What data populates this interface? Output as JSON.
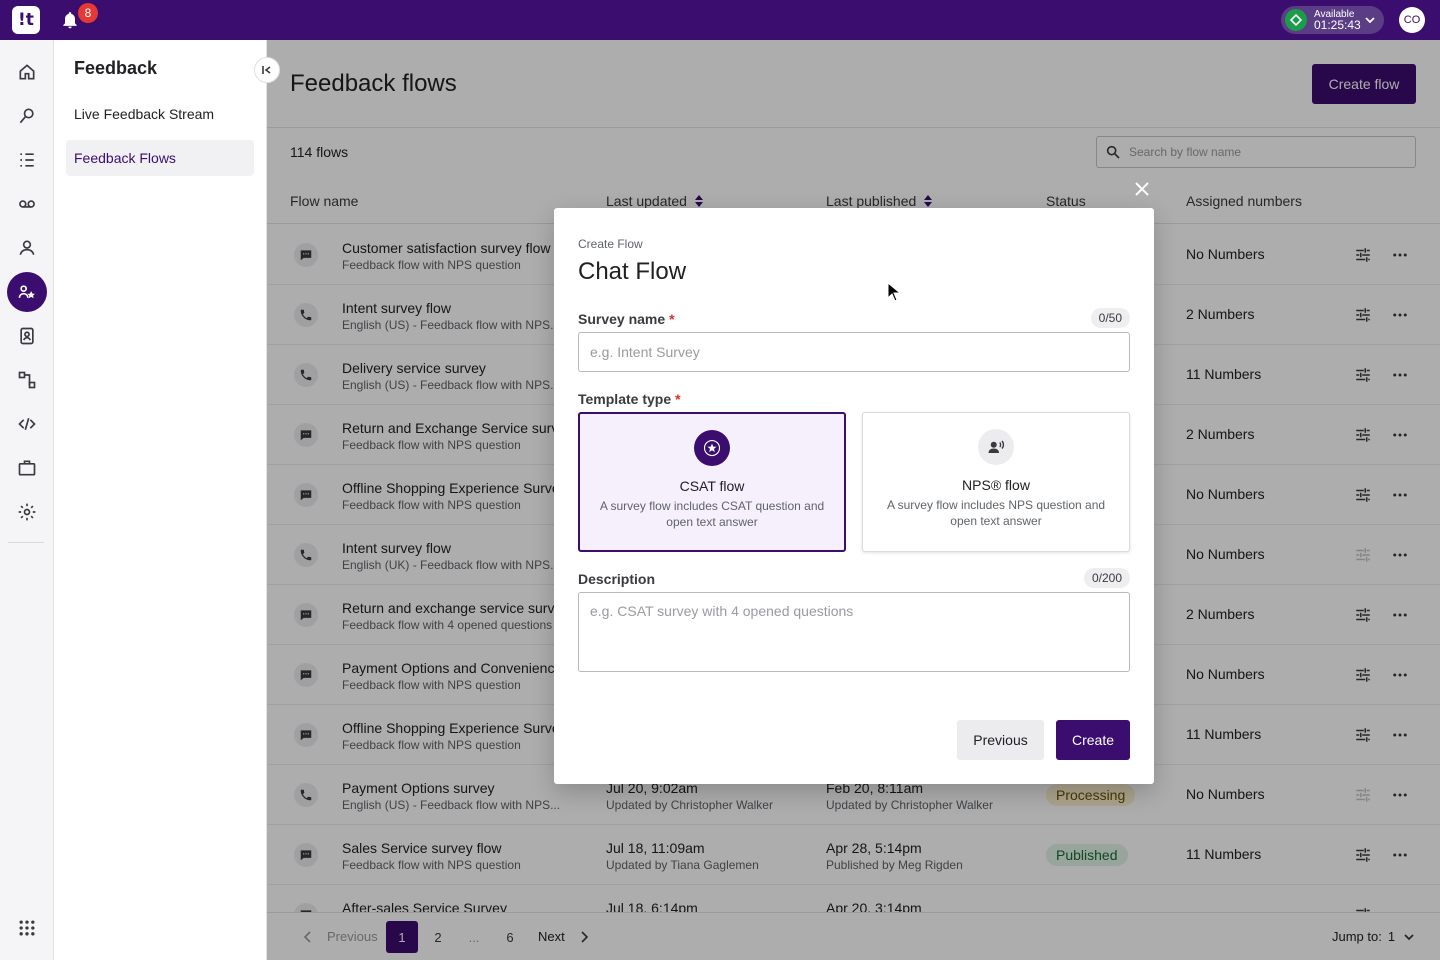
{
  "topbar": {
    "logo_text": "!t",
    "notifications_count": "8",
    "status_label": "Available",
    "status_timer": "01:25:43",
    "avatar_initials": "CO"
  },
  "rail": {
    "items": [
      "home-icon",
      "marketing-icon",
      "list-icon",
      "voicemail-icon",
      "agents-icon",
      "feedback-icon",
      "contacts-icon",
      "routing-icon",
      "code-icon",
      "briefcase-icon",
      "settings-icon",
      "apps-grid-icon"
    ],
    "active": "feedback-icon"
  },
  "sidebar": {
    "title": "Feedback",
    "items": [
      {
        "label": "Live Feedback Stream"
      },
      {
        "label": "Feedback Flows"
      }
    ]
  },
  "main": {
    "title": "Feedback flows",
    "create_label": "Create flow",
    "count": "114 flows",
    "search_placeholder": "Search by flow name",
    "columns": [
      "Flow name",
      "Last updated",
      "Last published",
      "Status",
      "Assigned numbers"
    ],
    "rows": [
      {
        "type": "chat",
        "name": "Customer satisfaction survey flow",
        "sub": "Feedback flow with NPS question",
        "updated": "",
        "updated_by": "",
        "published": "",
        "published_by": "",
        "status": "",
        "numbers": "No Numbers",
        "tune_disabled": false
      },
      {
        "type": "phone",
        "name": "Intent survey flow",
        "sub": "English (US) - Feedback flow with NPS...",
        "updated": "",
        "updated_by": "",
        "published": "",
        "published_by": "",
        "status": "",
        "numbers": "2 Numbers",
        "tune_disabled": false
      },
      {
        "type": "phone",
        "name": "Delivery service survey",
        "sub": "English (US) - Feedback flow with NPS...",
        "updated": "",
        "updated_by": "",
        "published": "",
        "published_by": "",
        "status": "",
        "numbers": "11 Numbers",
        "tune_disabled": false
      },
      {
        "type": "chat",
        "name": "Return and Exchange Service surv",
        "sub": "Feedback flow with NPS question",
        "updated": "",
        "updated_by": "",
        "published": "",
        "published_by": "",
        "status": "",
        "numbers": "2 Numbers",
        "tune_disabled": false
      },
      {
        "type": "chat",
        "name": "Offline Shopping Experience Surve",
        "sub": "Feedback flow with NPS question",
        "updated": "",
        "updated_by": "",
        "published": "",
        "published_by": "",
        "status": "",
        "numbers": "No Numbers",
        "tune_disabled": false
      },
      {
        "type": "phone",
        "name": "Intent survey flow",
        "sub": "English (UK) - Feedback flow with NPS...",
        "updated": "",
        "updated_by": "",
        "published": "",
        "published_by": "",
        "status": "",
        "numbers": "No Numbers",
        "tune_disabled": true
      },
      {
        "type": "chat",
        "name": "Return and exchange service surv",
        "sub": "Feedback flow with 4 opened questions",
        "updated": "",
        "updated_by": "",
        "published": "",
        "published_by": "",
        "status": "",
        "numbers": "2 Numbers",
        "tune_disabled": false
      },
      {
        "type": "chat",
        "name": "Payment Options and Convenienc",
        "sub": "Feedback flow with NPS question",
        "updated": "",
        "updated_by": "",
        "published": "",
        "published_by": "",
        "status": "",
        "numbers": "No Numbers",
        "tune_disabled": false
      },
      {
        "type": "chat",
        "name": "Offline Shopping Experience Surve",
        "sub": "Feedback flow with NPS question",
        "updated": "",
        "updated_by": "",
        "published": "",
        "published_by": "",
        "status": "",
        "numbers": "11 Numbers",
        "tune_disabled": false
      },
      {
        "type": "phone",
        "name": "Payment Options survey",
        "sub": "English (US) - Feedback flow with NPS...",
        "updated": "Jul 20, 9:02am",
        "updated_by": "Updated by Christopher Walker",
        "published": "Feb 20, 8:11am",
        "published_by": "Updated by Christopher Walker",
        "status": "Processing",
        "numbers": "No Numbers",
        "tune_disabled": true
      },
      {
        "type": "chat",
        "name": "Sales Service survey flow",
        "sub": "Feedback flow with NPS question",
        "updated": "Jul 18, 11:09am",
        "updated_by": "Updated by Tiana Gaglemen",
        "published": "Apr 28, 5:14pm",
        "published_by": "Published by Meg Rigden",
        "status": "Published",
        "numbers": "11 Numbers",
        "tune_disabled": false
      },
      {
        "type": "chat",
        "name": "After-sales Service Survey",
        "sub": "",
        "updated": "Jul 18, 6:14pm",
        "updated_by": "",
        "published": "Apr 20, 3:14pm",
        "published_by": "",
        "status": "",
        "numbers": "",
        "tune_disabled": false
      }
    ]
  },
  "pager": {
    "prev": "Previous",
    "pages": [
      "1",
      "2",
      "...",
      "6"
    ],
    "next": "Next",
    "jump_label": "Jump to:",
    "jump_value": "1"
  },
  "modal": {
    "crumb": "Create Flow",
    "title": "Chat Flow",
    "survey_label": "Survey name",
    "survey_counter": "0/50",
    "survey_placeholder": "e.g. Intent Survey",
    "template_label": "Template type",
    "templates": [
      {
        "title": "CSAT flow",
        "desc": "A survey flow includes CSAT question and open text answer",
        "selected": true
      },
      {
        "title": "NPS® flow",
        "desc": "A survey flow includes NPS question and open text answer",
        "selected": false
      }
    ],
    "desc_label": "Description",
    "desc_counter": "0/200",
    "desc_placeholder": "e.g. CSAT survey with 4 opened questions",
    "prev_label": "Previous",
    "create_label": "Create",
    "required_mark": "*"
  },
  "colors": {
    "brand": "#3b0d6e",
    "status_green": "#1b9c4a",
    "badge_red": "#e53935"
  }
}
